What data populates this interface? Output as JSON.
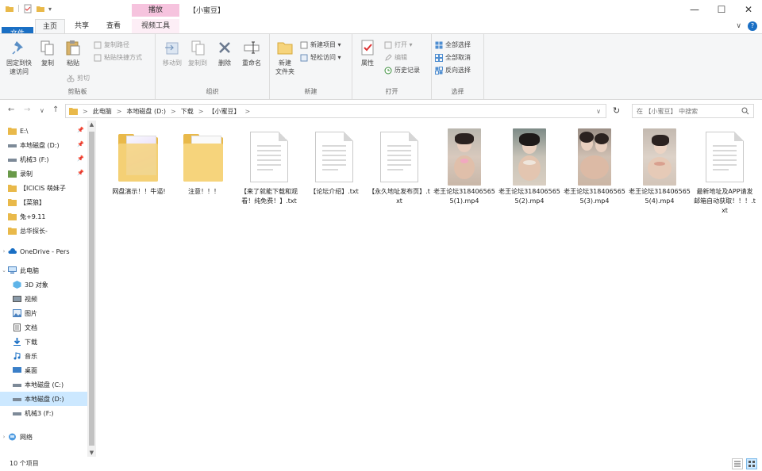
{
  "window": {
    "title": "【小蜜豆】",
    "context_tab_group": "播放",
    "controls": {
      "minimize": "—",
      "maximize": "☐",
      "close": "✕"
    }
  },
  "tabs": {
    "file": "文件",
    "home": "主页",
    "share": "共享",
    "view": "查看",
    "video_tools": "视频工具",
    "collapse": "∨",
    "help": "?"
  },
  "ribbon": {
    "clipboard": {
      "label": "剪贴板",
      "pin": "固定到快\n速访问",
      "copy": "复制",
      "paste": "粘贴",
      "copy_path": "复制路径",
      "paste_shortcut": "粘贴快捷方式",
      "cut": "剪切"
    },
    "organize": {
      "label": "组织",
      "move_to": "移动到",
      "copy_to": "复制到",
      "delete": "删除",
      "rename": "重命名"
    },
    "new": {
      "label": "新建",
      "new_folder": "新建\n文件夹",
      "new_item": "新建项目 ▾",
      "easy_access": "轻松访问 ▾"
    },
    "open": {
      "label": "打开",
      "properties": "属性",
      "open": "打开 ▾",
      "edit": "编辑",
      "history": "历史记录"
    },
    "select": {
      "label": "选择",
      "select_all": "全部选择",
      "select_none": "全部取消",
      "invert": "反向选择"
    }
  },
  "nav": {
    "back": "←",
    "forward": "→",
    "recent": "∨",
    "up": "↑",
    "breadcrumbs": [
      "此电脑",
      "本地磁盘 (D:)",
      "下载",
      "【小蜜豆】"
    ],
    "separator": ">",
    "refresh": "↻",
    "search_placeholder": "在 【小蜜豆】 中搜索"
  },
  "sidebar": {
    "items": [
      {
        "label": "E:\\",
        "icon": "folder-icon",
        "pinned": true
      },
      {
        "label": "本地磁盘 (D:)",
        "icon": "drive-icon",
        "pinned": true
      },
      {
        "label": "机械3 (F:)",
        "icon": "drive-icon",
        "pinned": true
      },
      {
        "label": "录制",
        "icon": "folder-icon",
        "pinned": true
      },
      {
        "label": "【ICICIS 萌妹子",
        "icon": "folder-icon",
        "pinned": false
      },
      {
        "label": "【菜狼】",
        "icon": "folder-icon",
        "pinned": false
      },
      {
        "label": "兔+9.11",
        "icon": "folder-icon",
        "pinned": false
      },
      {
        "label": "总华探长-",
        "icon": "folder-icon",
        "pinned": false
      },
      {
        "label": "OneDrive - Pers",
        "icon": "cloud-icon",
        "pinned": false
      },
      {
        "label": "此电脑",
        "icon": "computer-icon",
        "pinned": false
      },
      {
        "label": "3D 对象",
        "icon": "cube-icon",
        "pinned": false
      },
      {
        "label": "视频",
        "icon": "video-icon",
        "pinned": false
      },
      {
        "label": "图片",
        "icon": "picture-icon",
        "pinned": false
      },
      {
        "label": "文档",
        "icon": "document-icon",
        "pinned": false
      },
      {
        "label": "下载",
        "icon": "download-icon",
        "pinned": false
      },
      {
        "label": "音乐",
        "icon": "music-icon",
        "pinned": false
      },
      {
        "label": "桌面",
        "icon": "desktop-icon",
        "pinned": false
      },
      {
        "label": "本地磁盘 (C:)",
        "icon": "drive-icon",
        "pinned": false
      },
      {
        "label": "本地磁盘 (D:)",
        "icon": "drive-icon",
        "pinned": false,
        "selected": true
      },
      {
        "label": "机械3 (F:)",
        "icon": "drive-icon",
        "pinned": false
      },
      {
        "label": "网络",
        "icon": "network-icon",
        "pinned": false
      }
    ]
  },
  "files": [
    {
      "name": "网盘演示！！牛逼!",
      "type": "folder-preview"
    },
    {
      "name": "注意！！！",
      "type": "folder"
    },
    {
      "name": "【来了就能下载和观看！纯免费！】.txt",
      "type": "txt"
    },
    {
      "name": "【论坛介绍】.txt",
      "type": "txt"
    },
    {
      "name": "【永久地址发布页】.txt",
      "type": "txt"
    },
    {
      "name": "老王论坛3184065655(1).mp4",
      "type": "video"
    },
    {
      "name": "老王论坛3184065655(2).mp4",
      "type": "video"
    },
    {
      "name": "老王论坛3184065655(3).mp4",
      "type": "video"
    },
    {
      "name": "老王论坛3184065655(4).mp4",
      "type": "video"
    },
    {
      "name": "最新地址及APP请发邮箱自动获取！！！.txt",
      "type": "txt"
    }
  ],
  "status": {
    "count": "10 个项目"
  },
  "colors": {
    "accent": "#1a6fc4",
    "context_tab": "#f6c3de",
    "selection": "#cce8ff",
    "folder": "#f6d47c"
  }
}
